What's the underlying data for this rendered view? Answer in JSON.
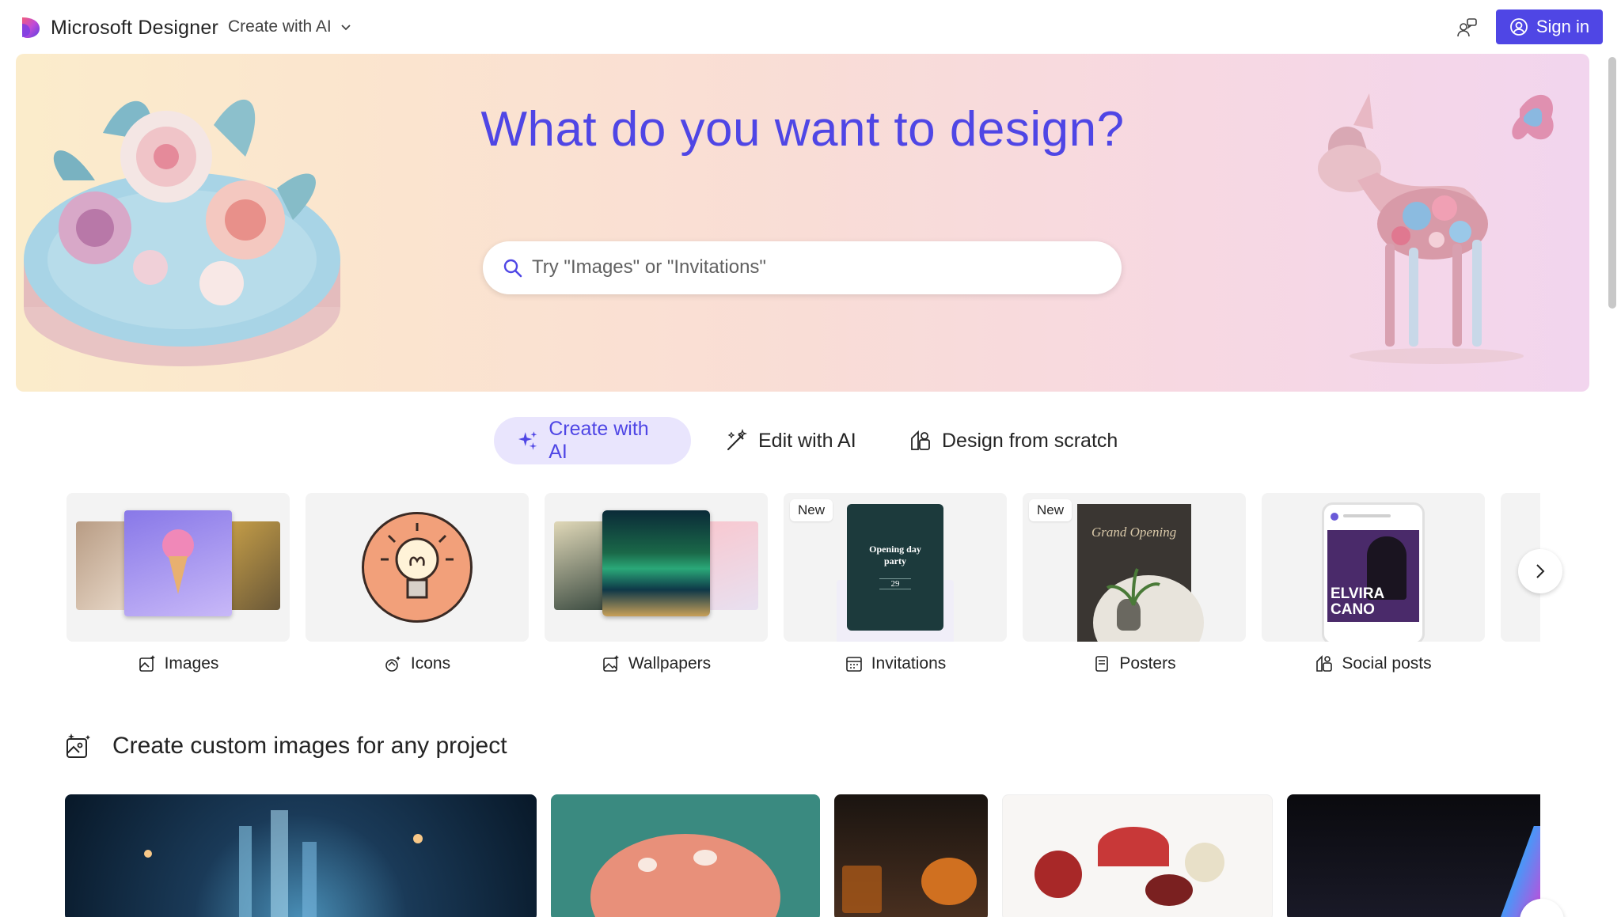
{
  "header": {
    "brand": "Microsoft Designer",
    "mode_menu_label": "Create with AI",
    "signin_label": "Sign in",
    "icons": {
      "logo": "designer-logo-icon",
      "mode_chevron": "chevron-down-icon",
      "feedback": "feedback-icon",
      "signin": "person-circle-icon"
    },
    "accent": "#4f46e5"
  },
  "hero": {
    "title": "What do you want to design?",
    "search_placeholder": "Try \"Images\" or \"Invitations\""
  },
  "tabs": [
    {
      "label": "Create with AI",
      "icon": "sparkle-icon",
      "active": true
    },
    {
      "label": "Edit with AI",
      "icon": "magic-wand-icon",
      "active": false
    },
    {
      "label": "Design from scratch",
      "icon": "shapes-icon",
      "active": false
    }
  ],
  "categories": [
    {
      "label": "Images",
      "icon": "image-sparkle-icon",
      "badge": ""
    },
    {
      "label": "Icons",
      "icon": "icon-sparkle-icon",
      "badge": ""
    },
    {
      "label": "Wallpapers",
      "icon": "wallpaper-icon",
      "badge": ""
    },
    {
      "label": "Invitations",
      "icon": "calendar-icon",
      "badge": "New",
      "card_text": {
        "line1": "Opening day",
        "line2": "party",
        "date": "29"
      }
    },
    {
      "label": "Posters",
      "icon": "document-icon",
      "badge": "New",
      "card_text": {
        "title": "Grand Opening"
      }
    },
    {
      "label": "Social posts",
      "icon": "social-post-icon",
      "badge": "",
      "card_text": {
        "name1": "ELVIRA",
        "name2": "CANO"
      }
    }
  ],
  "section": {
    "title": "Create custom images for any project",
    "icon": "image-sparkle-icon"
  }
}
